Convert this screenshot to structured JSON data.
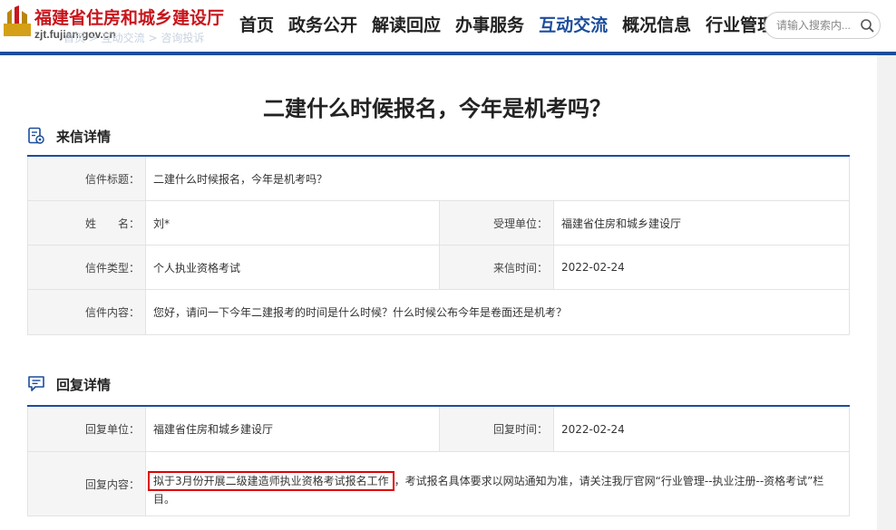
{
  "site": {
    "title": "福建省住房和城乡建设厅",
    "url": "zjt.fujian.gov.cn"
  },
  "nav": {
    "items": [
      {
        "label": "首页"
      },
      {
        "label": "政务公开"
      },
      {
        "label": "解读回应"
      },
      {
        "label": "办事服务"
      },
      {
        "label": "互动交流",
        "active": true
      },
      {
        "label": "概况信息"
      },
      {
        "label": "行业管理"
      }
    ]
  },
  "search": {
    "placeholder": "请输入搜索内..."
  },
  "breadcrumb": {
    "text": "首页 > 互动交流 > 咨询投诉"
  },
  "page": {
    "title": "二建什么时候报名，今年是机考吗？"
  },
  "letter": {
    "section_title": "来信详情",
    "subject_label": "信件标题：",
    "subject": "二建什么时候报名，今年是机考吗？",
    "name_label": "姓　　名：",
    "name": "刘*",
    "dept_label": "受理单位：",
    "dept": "福建省住房和城乡建设厅",
    "type_label": "信件类型：",
    "type": "个人执业资格考试",
    "date_label": "来信时间：",
    "date": "2022-02-24",
    "content_label": "信件内容：",
    "content": "您好，请问一下今年二建报考的时间是什么时候？什么时候公布今年是卷面还是机考？"
  },
  "reply": {
    "section_title": "回复详情",
    "unit_label": "回复单位：",
    "unit": "福建省住房和城乡建设厅",
    "date_label": "回复时间：",
    "date": "2022-02-24",
    "content_label": "回复内容：",
    "content_highlight": "拟于3月份开展二级建造师执业资格考试报名工作",
    "content_rest": "，考试报名具体要求以网站通知为准，请关注我厅官网“行业管理--执业注册--资格考试”栏目。"
  },
  "colors": {
    "brand_blue": "#1c4d9c",
    "logo_red": "#c8161d",
    "highlight_red": "#e00000"
  }
}
